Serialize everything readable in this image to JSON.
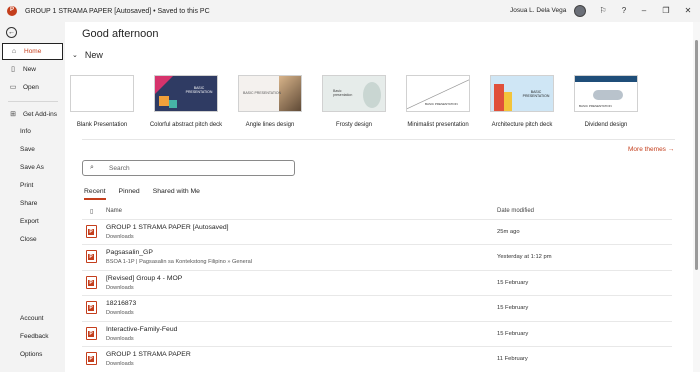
{
  "titlebar": {
    "doc_title": "GROUP 1 STRAMA PAPER [Autosaved] • Saved to this PC",
    "user_name": "Josua L. Dela Vega"
  },
  "sidebar": {
    "items": [
      {
        "label": "Home",
        "icon": "home-icon"
      },
      {
        "label": "New",
        "icon": "new-doc-icon"
      },
      {
        "label": "Open",
        "icon": "folder-open-icon"
      },
      {
        "label": "Get Add-ins",
        "icon": "grid-icon"
      },
      {
        "label": "Info"
      },
      {
        "label": "Save"
      },
      {
        "label": "Save As"
      },
      {
        "label": "Print"
      },
      {
        "label": "Share"
      },
      {
        "label": "Export"
      },
      {
        "label": "Close"
      }
    ],
    "bottom": [
      "Account",
      "Feedback",
      "Options"
    ]
  },
  "main": {
    "greeting": "Good afternoon",
    "new_heading": "New",
    "templates": [
      {
        "name": "Blank Presentation",
        "thumb_text": ""
      },
      {
        "name": "Colorful abstract pitch deck",
        "thumb_text": "BASIC PRESENTATION"
      },
      {
        "name": "Angle lines design",
        "thumb_text": "BASIC PRESENTATION"
      },
      {
        "name": "Frosty design",
        "thumb_text": "Basic presentation"
      },
      {
        "name": "Minimalist presentation",
        "thumb_text": "BASIC PRESENTATION"
      },
      {
        "name": "Architecture pitch deck",
        "thumb_text": "BASIC PRESENTATION"
      },
      {
        "name": "Dividend design",
        "thumb_text": "BASIC PRESENTATION"
      }
    ],
    "more_themes": "More themes →",
    "search_placeholder": "Search",
    "tabs": [
      "Recent",
      "Pinned",
      "Shared with Me"
    ],
    "columns": {
      "name": "Name",
      "date": "Date modified"
    },
    "files": [
      {
        "name": "GROUP 1 STRAMA PAPER [Autosaved]",
        "location": "Downloads",
        "date": "25m ago"
      },
      {
        "name": "Pagsasalin_GP",
        "location": "BSOA 1-1P | Pagsasalin sa Kontekstong Filipino » General",
        "date": "Yesterday at 1:12 pm"
      },
      {
        "name": "[Revised] Group 4 - MOP",
        "location": "Downloads",
        "date": "15 February"
      },
      {
        "name": "18216873",
        "location": "Downloads",
        "date": "15 February"
      },
      {
        "name": "Interactive-Family-Feud",
        "location": "Downloads",
        "date": "15 February"
      },
      {
        "name": "GROUP 1 STRAMA PAPER",
        "location": "Downloads",
        "date": "11 February"
      }
    ]
  },
  "colors": {
    "accent": "#c43e1c",
    "sidebar_bg": "#f3f3f3"
  }
}
